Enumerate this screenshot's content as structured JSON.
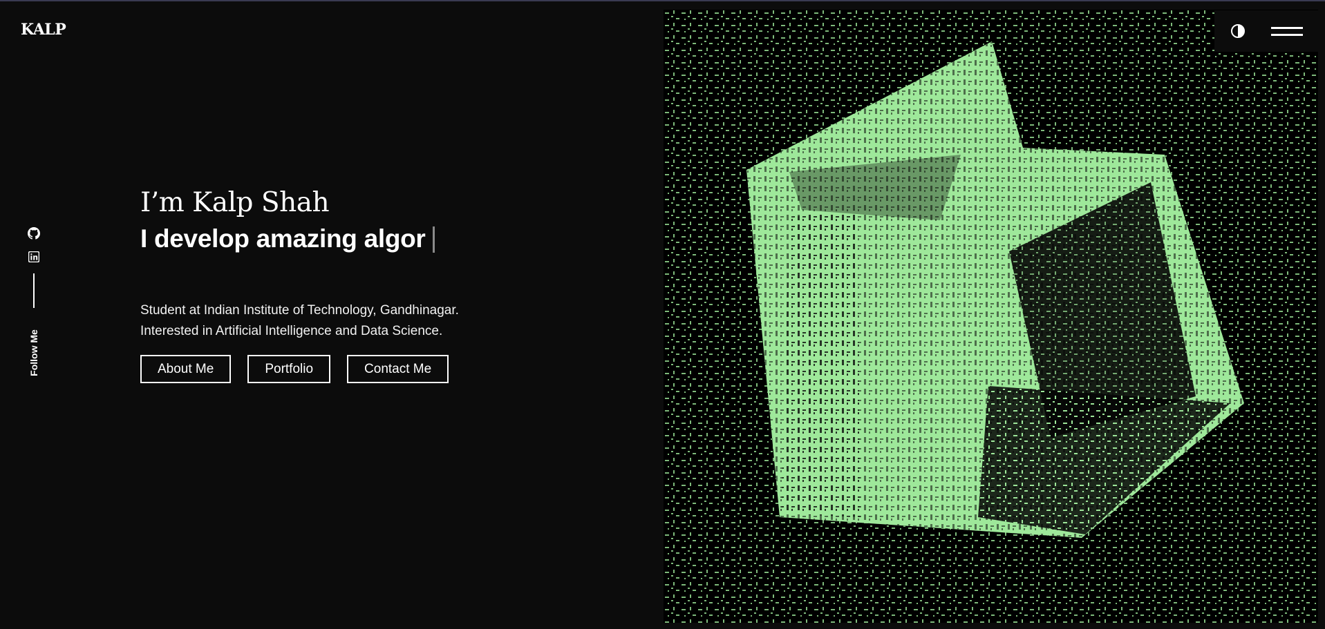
{
  "header": {
    "logo": "KALP"
  },
  "social": {
    "follow_label": "Follow Me",
    "links": [
      {
        "icon": "github-icon"
      },
      {
        "icon": "linkedin-icon"
      }
    ]
  },
  "hero": {
    "greeting": "I’m Kalp Shah",
    "typing_text": "I develop amazing algor",
    "description_line1": "Student at Indian Institute of Technology, Gandhinagar.",
    "description_line2": "Interested in Artificial Intelligence and Data Science."
  },
  "buttons": {
    "about": "About Me",
    "portfolio": "Portfolio",
    "contact": "Contact Me"
  },
  "controls": {
    "theme_icon": "contrast-icon",
    "menu_icon": "hamburger-menu-icon"
  },
  "art": {
    "icon": "ascii-cube-icon",
    "colors": {
      "accent": "#9ee89a",
      "background": "#000000"
    }
  }
}
